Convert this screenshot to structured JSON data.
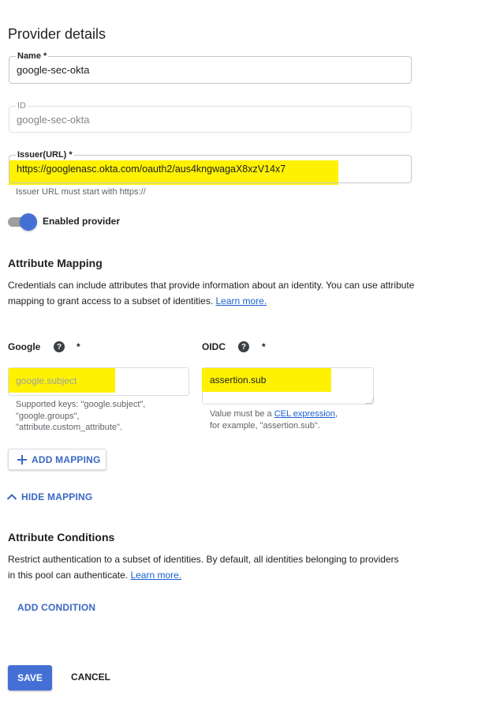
{
  "provider_details": {
    "title": "Provider details",
    "name_label": "Name *",
    "name_value": "google-sec-okta",
    "id_label": "ID",
    "id_value": "google-sec-okta",
    "issuer_label": "Issuer(URL) *",
    "issuer_value": "https://googlenasc.okta.com/oauth2/aus4kngwagaX8xzV14x7",
    "issuer_helper": "Issuer URL must start with https://",
    "toggle_label": "Enabled provider",
    "toggle_on": true
  },
  "attribute_mapping": {
    "title": "Attribute Mapping",
    "description": "Credentials can include attributes that provide information about an identity. You can use attribute mapping to grant access to a subset of identities.",
    "learn_more": "Learn more.",
    "google_header": "Google",
    "oidc_header": "OIDC",
    "required_star": "*",
    "help_icon_glyph": "?",
    "google_placeholder": "google.subject",
    "oidc_value": "assertion.sub",
    "google_helper_1": "Supported keys: \"google.subject\",",
    "google_helper_2": "\"google.groups\",",
    "google_helper_3": "\"attribute.custom_attribute\".",
    "oidc_helper_prefix": "Value must be a ",
    "oidc_helper_link": "CEL expression",
    "oidc_helper_suffix": ",",
    "oidc_helper_2": "for example, \"assertion.sub\".",
    "add_mapping": "ADD MAPPING",
    "hide_mapping": "HIDE MAPPING"
  },
  "attribute_conditions": {
    "title": "Attribute Conditions",
    "description": "Restrict authentication to a subset of identities. By default, all identities belonging to providers in this pool can authenticate.",
    "learn_more": "Learn more.",
    "add_condition": "ADD CONDITION"
  },
  "actions": {
    "save": "SAVE",
    "cancel": "CANCEL"
  },
  "colors": {
    "primary": "#4470d6",
    "link": "#1a5fd1",
    "highlight": "#fff200"
  }
}
